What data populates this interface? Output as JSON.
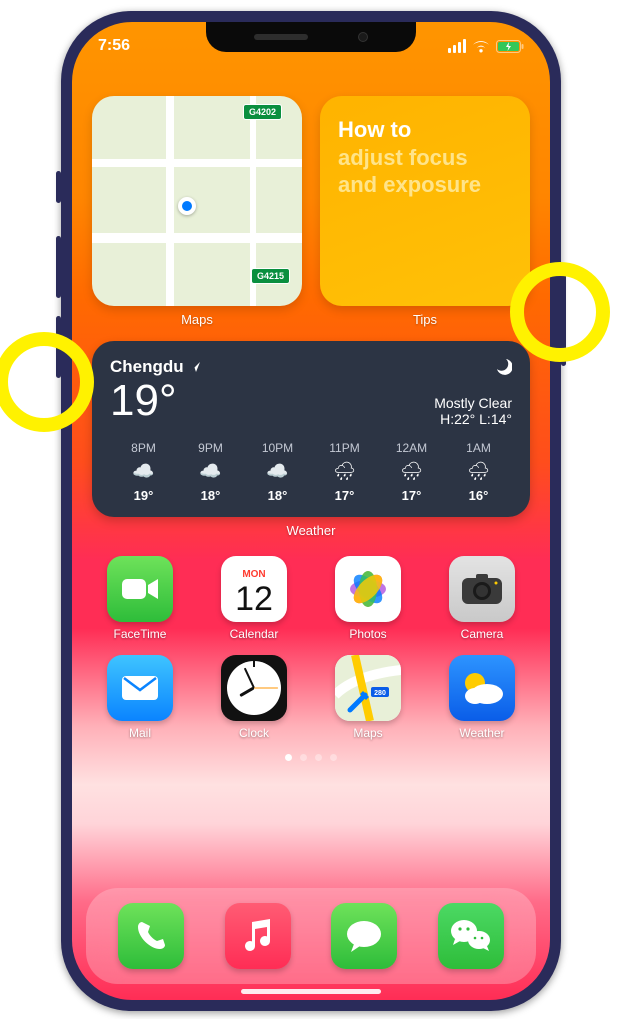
{
  "status": {
    "time": "7:56"
  },
  "widgets": {
    "maps": {
      "label": "Maps",
      "route1": "G4202",
      "route2": "G4215"
    },
    "tips": {
      "label": "Tips",
      "line1": "How to",
      "line2": "adjust focus and exposure"
    }
  },
  "weather": {
    "label": "Weather",
    "city": "Chengdu",
    "temp": "19°",
    "condition": "Mostly Clear",
    "hilo": "H:22° L:14°",
    "hours": [
      {
        "time": "8PM",
        "icon": "cloud-night",
        "temp": "19°"
      },
      {
        "time": "9PM",
        "icon": "cloud-night",
        "temp": "18°"
      },
      {
        "time": "10PM",
        "icon": "cloud-night",
        "temp": "18°"
      },
      {
        "time": "11PM",
        "icon": "rain",
        "temp": "17°"
      },
      {
        "time": "12AM",
        "icon": "rain",
        "temp": "17°"
      },
      {
        "time": "1AM",
        "icon": "rain",
        "temp": "16°"
      }
    ]
  },
  "apps": [
    {
      "name": "FaceTime",
      "icon": "facetime"
    },
    {
      "name": "Calendar",
      "icon": "calendar",
      "day": "MON",
      "date": "12"
    },
    {
      "name": "Photos",
      "icon": "photos"
    },
    {
      "name": "Camera",
      "icon": "camera"
    },
    {
      "name": "Mail",
      "icon": "mail"
    },
    {
      "name": "Clock",
      "icon": "clock"
    },
    {
      "name": "Maps",
      "icon": "mapsapp"
    },
    {
      "name": "Weather",
      "icon": "weatherapp"
    }
  ],
  "dock": [
    {
      "name": "Phone",
      "icon": "phone"
    },
    {
      "name": "Music",
      "icon": "music"
    },
    {
      "name": "Messages",
      "icon": "messages"
    },
    {
      "name": "WeChat",
      "icon": "wechat"
    }
  ],
  "colors": {
    "yellow_annot": "#fff200",
    "green": "#2ebd3a",
    "blue": "#0a84ff",
    "red": "#ff2d55"
  }
}
